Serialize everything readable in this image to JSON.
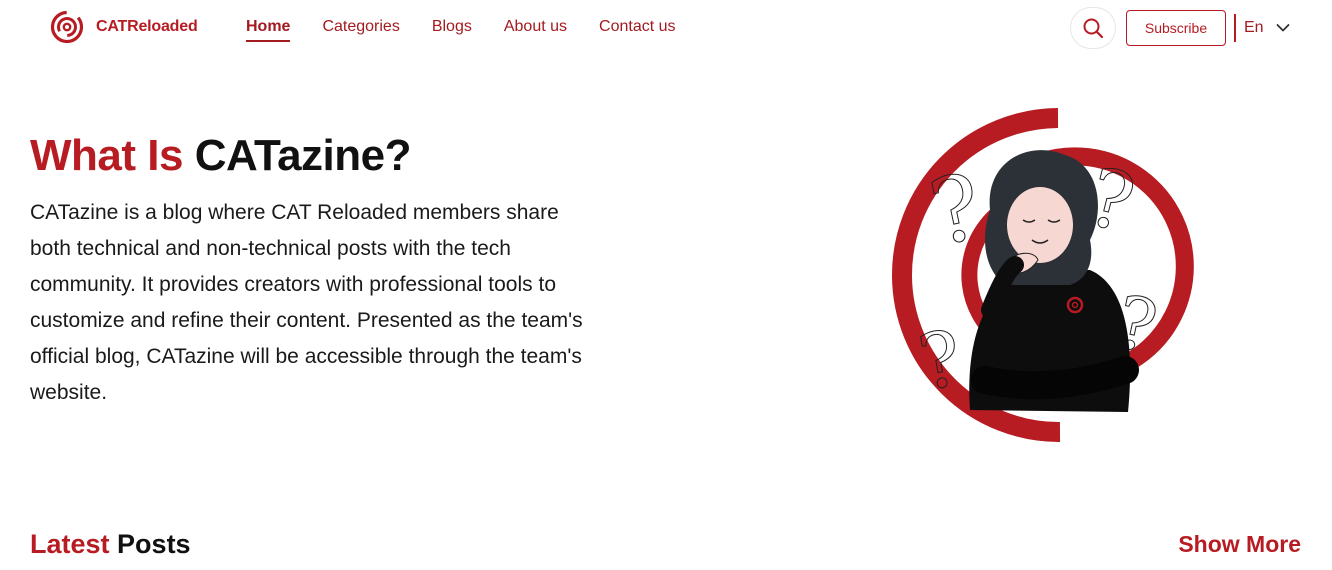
{
  "header": {
    "logo_text": "CATReloaded",
    "nav": [
      {
        "label": "Home",
        "active": true
      },
      {
        "label": "Categories",
        "active": false
      },
      {
        "label": "Blogs",
        "active": false
      },
      {
        "label": "About us",
        "active": false
      },
      {
        "label": "Contact us",
        "active": false
      }
    ],
    "search_icon": "search-icon",
    "subscribe_label": "Subscribe",
    "language": "En",
    "language_icon": "chevron-down-icon"
  },
  "hero": {
    "title_accent": "What Is",
    "title_dark": "CATazine?",
    "description": "CATazine is a blog where CAT Reloaded members share both technical and non-technical posts with the tech community. It provides creators with professional tools to customize and refine their content. Presented as the team's official blog, CATazine will be accessible through the team's website."
  },
  "latest": {
    "title_accent": "Latest",
    "title_dark": "Posts",
    "show_more_label": "Show More"
  },
  "colors": {
    "brand": "#b71c22",
    "nav_text": "#a31b20",
    "text": "#111111",
    "background": "#ffffff"
  }
}
